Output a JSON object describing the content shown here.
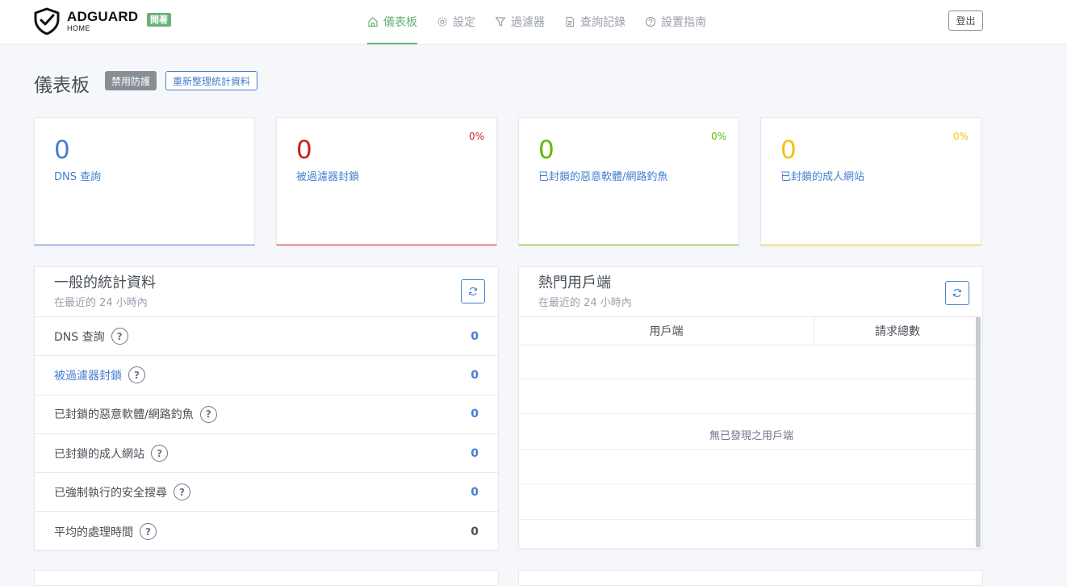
{
  "header": {
    "brand": "ADGUARD",
    "brand_sub": "HOME",
    "status": "開著",
    "nav": [
      {
        "label": "儀表板",
        "icon": "home-icon"
      },
      {
        "label": "設定",
        "icon": "gear-icon"
      },
      {
        "label": "過濾器",
        "icon": "filter-icon"
      },
      {
        "label": "查詢記錄",
        "icon": "document-icon"
      },
      {
        "label": "設置指南",
        "icon": "help-circle-icon"
      }
    ],
    "logout": "登出"
  },
  "page": {
    "title": "儀表板",
    "disable_protection": "禁用防護",
    "refresh_stats": "重新整理統計資料"
  },
  "stats": [
    {
      "value": "0",
      "label": "DNS 查詢",
      "percent": "",
      "color": "#467fcf"
    },
    {
      "value": "0",
      "label": "被過濾器封鎖",
      "percent": "0%",
      "color": "#cd201f"
    },
    {
      "value": "0",
      "label": "已封鎖的惡意軟體/網路釣魚",
      "percent": "0%",
      "color": "#5eba00"
    },
    {
      "value": "0",
      "label": "已封鎖的成人網站",
      "percent": "0%",
      "color": "#f1c40f"
    }
  ],
  "general": {
    "title": "一般的統計資料",
    "subtitle": "在最近的 24 小時內",
    "rows": [
      {
        "label": "DNS 查詢",
        "value": "0"
      },
      {
        "label": "被過濾器封鎖",
        "value": "0"
      },
      {
        "label": "已封鎖的惡意軟體/網路釣魚",
        "value": "0"
      },
      {
        "label": "已封鎖的成人網站",
        "value": "0"
      },
      {
        "label": "已強制執行的安全搜尋",
        "value": "0"
      },
      {
        "label": "平均的處理時間",
        "value": "0"
      }
    ],
    "help_glyph": "?"
  },
  "clients": {
    "title": "熱門用戶端",
    "subtitle": "在最近的 24 小時內",
    "col_client": "用戶端",
    "col_requests": "請求總數",
    "empty": "無已發現之用戶端"
  }
}
